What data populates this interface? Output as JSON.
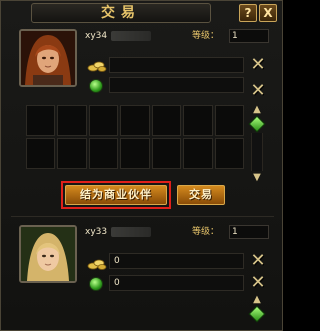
{
  "window": {
    "title": "交易",
    "help_label": "?",
    "close_label": "X"
  },
  "other_player": {
    "name": "xy34",
    "level_label": "等级：",
    "level": "1",
    "money_value": "",
    "gem_value": ""
  },
  "self_player": {
    "name": "xy33",
    "level_label": "等级：",
    "level": "1",
    "money_value": "0",
    "gem_value": "0"
  },
  "buttons": {
    "partner": "结为商业伙伴",
    "trade": "交易"
  },
  "icons": {
    "coin": "gold-coins-icon",
    "gem": "green-gem-icon",
    "remove": "x-icon",
    "scroll_up": "up-arrow-icon",
    "scroll_down": "down-arrow-icon"
  },
  "colors": {
    "accent": "#e7c46a",
    "button": "#d48a1e",
    "highlight_outline": "#e0201a"
  }
}
